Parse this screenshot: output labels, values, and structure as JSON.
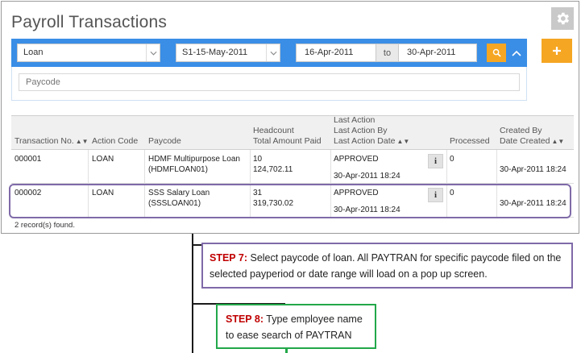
{
  "header": {
    "title": "Payroll Transactions"
  },
  "filters": {
    "transaction_type": "Loan",
    "payroll_period": "S1-15-May-2011",
    "date_from": "16-Apr-2011",
    "to_label": "to",
    "date_to": "30-Apr-2011",
    "paycode_placeholder": "Paycode"
  },
  "icons": {
    "settings": "gear-icon",
    "search": "search-icon",
    "collapse": "chevron-up-icon",
    "add": "plus-icon",
    "info": "info-icon"
  },
  "table": {
    "columns": {
      "transaction_no": "Transaction No.",
      "action_code": "Action Code",
      "paycode": "Paycode",
      "amount_line1": "Headcount",
      "amount_line2": "Total Amount Paid",
      "last_line1": "Last Action",
      "last_line2": "Last Action By",
      "last_line3": "Last Action Date",
      "processed": "Processed",
      "created_line1": "Created By",
      "created_line2": "Date Created"
    },
    "rows": [
      {
        "transaction_no": "000001",
        "action_code": "LOAN",
        "paycode_name": "HDMF Multipurpose Loan",
        "paycode_code": "(HDMFLOAN01)",
        "headcount": "10",
        "amount": "124,702.11",
        "last_action": "APPROVED",
        "last_action_date": "30-Apr-2011 18:24",
        "info_label": "i",
        "processed": "0",
        "date_created": "30-Apr-2011 18:24"
      },
      {
        "transaction_no": "000002",
        "action_code": "LOAN",
        "paycode_name": "SSS Salary Loan",
        "paycode_code": "(SSSLOAN01)",
        "headcount": "31",
        "amount": "319,730.02",
        "last_action": "APPROVED",
        "last_action_date": "30-Apr-2011 18:24",
        "info_label": "i",
        "processed": "0",
        "date_created": "30-Apr-2011 18:24"
      }
    ],
    "record_count": "2 record(s) found."
  },
  "annotations": {
    "step7_label": "STEP 7:",
    "step7_text": " Select paycode of loan. All PAYTRAN for specific paycode filed on the selected payperiod or date range will load on a pop up screen.",
    "step8_label": "STEP 8:",
    "step8_text": " Type employee name to ease search of PAYTRAN",
    "step7_border": "#7f6aa8",
    "step8_border": "#22a84a",
    "step_label_color": "#c00000"
  },
  "colors": {
    "filter_bar": "#3a8ee6",
    "accent": "#f5a623",
    "header_bg": "#f0f0f0"
  }
}
